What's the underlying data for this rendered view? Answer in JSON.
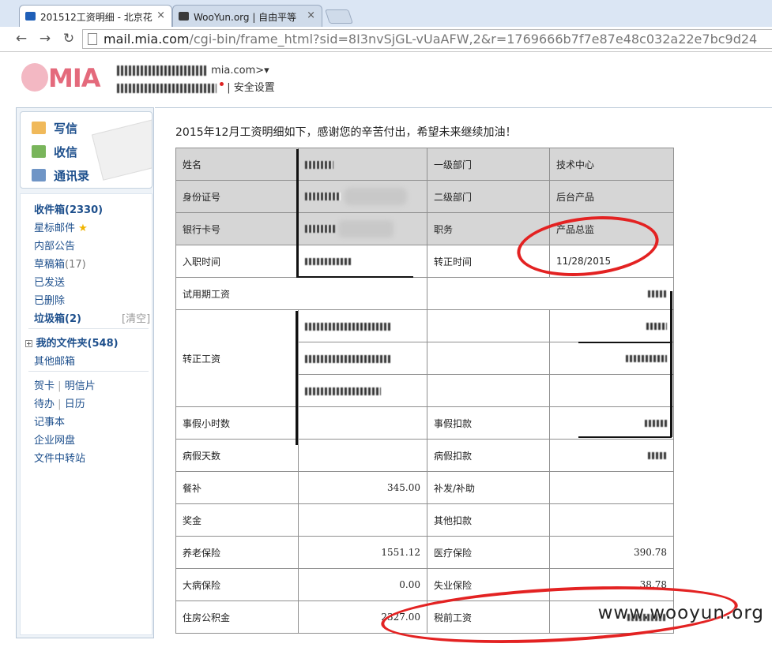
{
  "browser": {
    "tabs": [
      {
        "title": "201512工资明细 - 北京花",
        "active": true
      },
      {
        "title": "WooYun.org | 自由平等",
        "active": false
      }
    ],
    "url_host": "mail.mia.com",
    "url_path": "/cgi-bin/frame_html?sid=8I3nvSjGL-vUaAFW,2&r=1769666b7f7e87e48c032a22e7bc9d24"
  },
  "mail_header": {
    "logo_text": "MIA",
    "account_suffix": "mia.com>",
    "dropdown": "▾",
    "settings_link": "| 安全设置"
  },
  "sidebar": {
    "compose": "写信",
    "inbox_check": "收信",
    "contacts": "通讯录",
    "inbox": "收件箱(2330)",
    "starred": "星标邮件",
    "internal": "内部公告",
    "drafts_label": "草稿箱",
    "drafts_count": "(17)",
    "sent": "已发送",
    "deleted": "已删除",
    "spam": "垃圾箱(2)",
    "spam_clear": "[清空]",
    "my_folders": "我的文件夹(548)",
    "other_mail": "其他邮箱",
    "greeting_card": "贺卡",
    "postcard": "明信片",
    "todo": "待办",
    "calendar": "日历",
    "notes": "记事本",
    "netdisk": "企业网盘",
    "transfer": "文件中转站"
  },
  "mail": {
    "intro": "2015年12月工资明细如下，感谢您的辛苦付出，希望未来继续加油！",
    "rows": {
      "name": "姓名",
      "dept1": "一级部门",
      "dept1_val": "技术中心",
      "id_no": "身份证号",
      "dept2": "二级部门",
      "dept2_val": "后台产品",
      "bank_card": "银行卡号",
      "position": "职务",
      "position_val": "产品总监",
      "hire_date": "入职时间",
      "regular_date": "转正时间",
      "regular_date_val": "11/28/2015",
      "probation_salary": "试用期工资",
      "regular_salary": "转正工资",
      "leave_hours": "事假小时数",
      "leave_deduct": "事假扣款",
      "sick_days": "病假天数",
      "sick_deduct": "病假扣款",
      "meal": "餐补",
      "meal_val": "345.00",
      "supplement": "补发/补助",
      "bonus": "奖金",
      "other_deduct": "其他扣款",
      "pension": "养老保险",
      "pension_val": "1551.12",
      "medical": "医疗保险",
      "medical_val": "390.78",
      "major_illness": "大病保险",
      "major_illness_val": "0.00",
      "unemployment": "失业保险",
      "unemployment_val": "38.78",
      "housing_fund": "住房公积金",
      "housing_fund_val": "2327.00",
      "pretax_salary": "税前工资"
    }
  },
  "watermark": "www.wooyun.org"
}
